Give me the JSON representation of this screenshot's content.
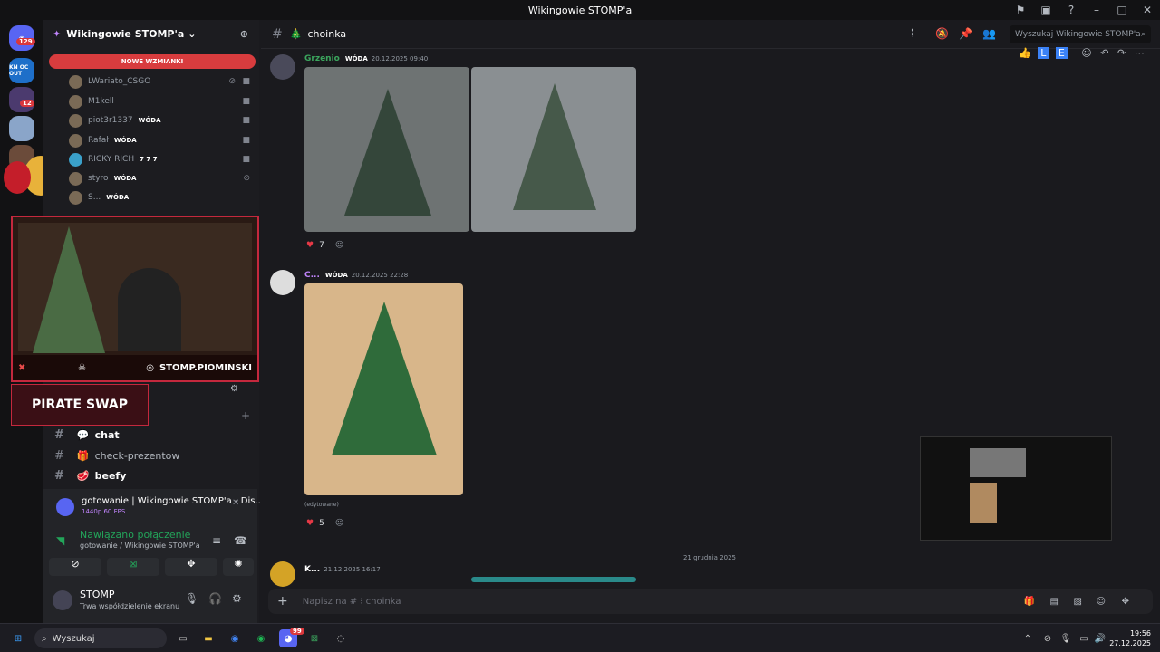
{
  "window": {
    "title": "Wikingowie STOMP'a"
  },
  "servers": {
    "badge1": "129",
    "badge2": "12",
    "server2_label": "KN OC OUT"
  },
  "sidebar": {
    "guild_name": "Wikingowie STOMP'a",
    "mentions_label": "NOWE WZMIANKI",
    "voice_users": [
      {
        "name": "LWariato_CSGO",
        "tag": ""
      },
      {
        "name": "M1kell",
        "tag": ""
      },
      {
        "name": "piot3r1337",
        "tag": "WÓDA"
      },
      {
        "name": "Rafał",
        "tag": "WÓDA"
      },
      {
        "name": "RICKY RICH",
        "tag": "7 7 7"
      },
      {
        "name": "styro",
        "tag": "WÓDA"
      },
      {
        "name": "S...",
        "tag": "WÓDA"
      }
    ],
    "channels": [
      {
        "name": "chat"
      },
      {
        "name": "check-prezentow"
      },
      {
        "name": "beefy"
      }
    ]
  },
  "overlay": {
    "brand": "PIRATE SWAP",
    "instagram": "STOMP.PIOMINSKI"
  },
  "stream": {
    "title": "gotowanie | Wikingowie STOMP'a - Dis...",
    "quality": "1440p 60 FPS",
    "connected": "Nawiązano połączenie",
    "channel": "gotowanie / Wikingowie STOMP'a"
  },
  "user": {
    "name": "STOMP",
    "status": "Trwa współdzielenie ekranu"
  },
  "main": {
    "channel": "choinka",
    "search_placeholder": "Wyszukaj Wikingowie STOMP'a",
    "messages": [
      {
        "author": "Grzenio",
        "role": "WÓDA",
        "time": "20.12.2025 09:40",
        "reaction_count": "7"
      },
      {
        "author": "C...",
        "role": "WÓDA",
        "time": "20.12.2025 22:28",
        "edited": "(edytowane)",
        "reaction_count": "5"
      },
      {
        "author": "K...",
        "role": "",
        "time": "21.12.2025 16:17"
      }
    ],
    "date_divider": "21 grudnia 2025",
    "compose_placeholder": "Napisz na # ⁝ choinka"
  },
  "taskbar": {
    "search": "Wyszukaj",
    "discord_badge": "99",
    "time": "19:56",
    "date": "27.12.2025"
  },
  "colors": {
    "accent": "#d83c3e",
    "green": "#23a55a",
    "bg": "#1a1a1e"
  }
}
